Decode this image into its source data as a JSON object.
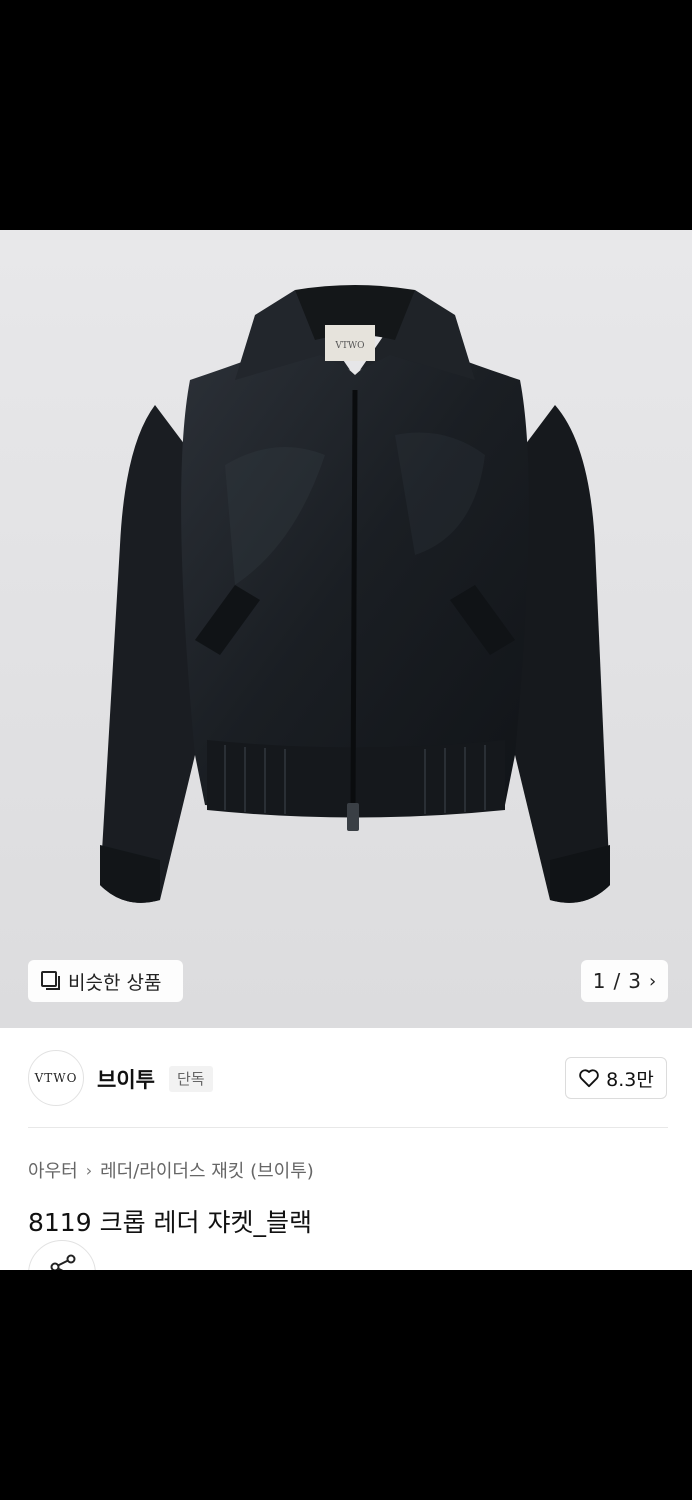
{
  "gallery": {
    "similar_label": "비슷한 상품",
    "label_tag": "VTWO",
    "page_current": "1",
    "page_sep": "/",
    "page_total": "3"
  },
  "store": {
    "logo_text": "VTWO",
    "name": "브이투",
    "badge": "단독",
    "likes": "8.3만"
  },
  "breadcrumb": {
    "category": "아우터",
    "subcategory": "레더/라이더스 재킷 (브이투)"
  },
  "product": {
    "title": "8119 크롭 레더 쟈켓_블랙"
  },
  "colors": {
    "jacket": "#1b1f24",
    "background": "#e3e3e5"
  }
}
